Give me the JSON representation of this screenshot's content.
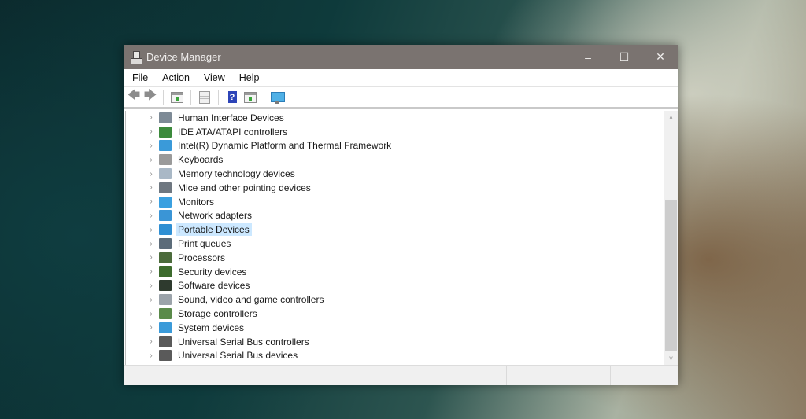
{
  "window": {
    "title": "Device Manager",
    "controls": {
      "minimize": "–",
      "maximize": "☐",
      "close": "✕"
    }
  },
  "menu": [
    "File",
    "Action",
    "View",
    "Help"
  ],
  "toolbar": {
    "buttons": [
      {
        "name": "back",
        "glyph": "🡄"
      },
      {
        "name": "forward",
        "glyph": "🡆"
      },
      {
        "name": "show-hide-console-tree"
      },
      {
        "name": "properties"
      },
      {
        "name": "help",
        "glyph": "?"
      },
      {
        "name": "show-action-pane"
      },
      {
        "name": "scan-for-hardware-changes"
      }
    ]
  },
  "tree": {
    "expander_glyph": "›",
    "selected_index": 8,
    "items": [
      {
        "label": "Human Interface Devices",
        "icon": "hid-icon",
        "color": "#7d8a96"
      },
      {
        "label": "IDE ATA/ATAPI controllers",
        "icon": "ide-controller-icon",
        "color": "#3c8a3c"
      },
      {
        "label": "Intel(R) Dynamic Platform and Thermal Framework",
        "icon": "system-folder-icon",
        "color": "#3a9ad9"
      },
      {
        "label": "Keyboards",
        "icon": "keyboard-icon",
        "color": "#9a9a9a"
      },
      {
        "label": "Memory technology devices",
        "icon": "memory-device-icon",
        "color": "#a9b8c6"
      },
      {
        "label": "Mice and other pointing devices",
        "icon": "mouse-icon",
        "color": "#6e7780"
      },
      {
        "label": "Monitors",
        "icon": "monitor-icon",
        "color": "#3aa0e0"
      },
      {
        "label": "Network adapters",
        "icon": "network-adapter-icon",
        "color": "#3a95d6"
      },
      {
        "label": "Portable Devices",
        "icon": "portable-device-icon",
        "color": "#2f8fd3"
      },
      {
        "label": "Print queues",
        "icon": "printer-icon",
        "color": "#5c6c7a"
      },
      {
        "label": "Processors",
        "icon": "processor-icon",
        "color": "#4b6b3b"
      },
      {
        "label": "Security devices",
        "icon": "security-device-icon",
        "color": "#3d6b2d"
      },
      {
        "label": "Software devices",
        "icon": "software-device-icon",
        "color": "#2e3a2e"
      },
      {
        "label": "Sound, video and game controllers",
        "icon": "speaker-icon",
        "color": "#9ba3aa"
      },
      {
        "label": "Storage controllers",
        "icon": "storage-controller-icon",
        "color": "#5a8a4a"
      },
      {
        "label": "System devices",
        "icon": "system-devices-icon",
        "color": "#3a9ad9"
      },
      {
        "label": "Universal Serial Bus controllers",
        "icon": "usb-icon",
        "color": "#5a5a5a"
      },
      {
        "label": "Universal Serial Bus devices",
        "icon": "usb-icon",
        "color": "#5a5a5a"
      }
    ]
  },
  "scrollbar": {
    "up": "˄",
    "down": "˅",
    "position_fraction": 1.0,
    "visible_fraction": 0.66
  },
  "statusbar": {
    "cells": [
      "",
      "",
      ""
    ]
  }
}
